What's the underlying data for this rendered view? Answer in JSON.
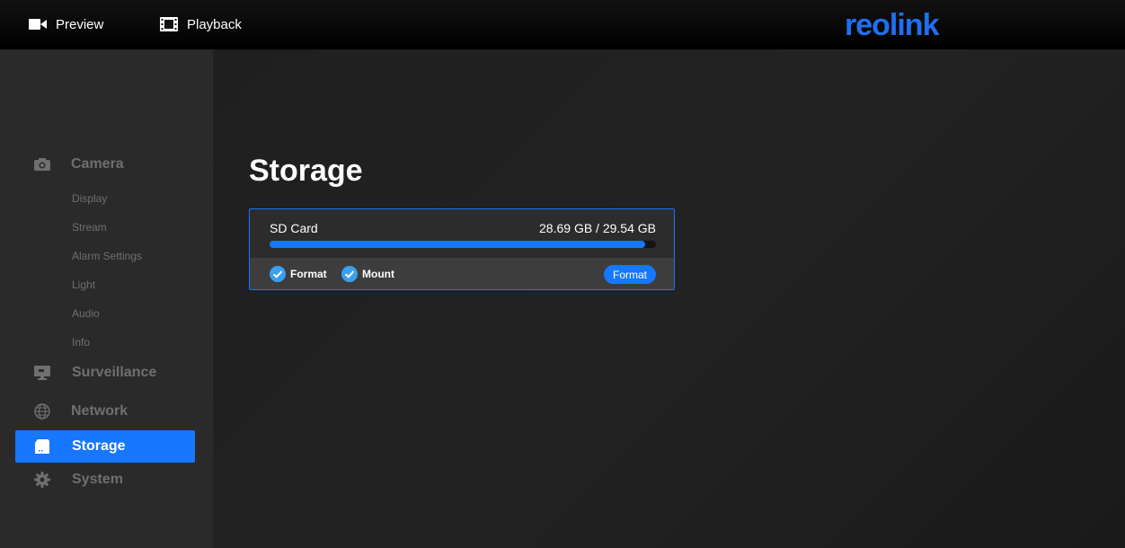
{
  "topbar": {
    "preview_label": "Preview",
    "playback_label": "Playback",
    "logo_text": "reolink",
    "logo_color": "#1f6ff0"
  },
  "sidebar": {
    "camera": {
      "label": "Camera",
      "icon": "camera-icon",
      "items": [
        "Display",
        "Stream",
        "Alarm Settings",
        "Light",
        "Audio",
        "Info"
      ]
    },
    "surveillance": {
      "label": "Surveillance",
      "icon": "monitor-icon"
    },
    "network": {
      "label": "Network",
      "icon": "globe-icon"
    },
    "storage": {
      "label": "Storage",
      "icon": "sd-card-icon",
      "active": true
    },
    "system": {
      "label": "System",
      "icon": "gear-icon"
    }
  },
  "main": {
    "title": "Storage",
    "card": {
      "name": "SD Card",
      "usage": "28.69 GB / 29.54 GB",
      "usage_fraction": 0.971,
      "checkboxes": [
        {
          "label": "Format",
          "checked": true
        },
        {
          "label": "Mount",
          "checked": true
        }
      ],
      "format_button": "Format"
    }
  },
  "colors": {
    "accent": "#1677ff",
    "sidebar_bg": "#2a2a2a",
    "muted_text": "#6f6f6f"
  }
}
